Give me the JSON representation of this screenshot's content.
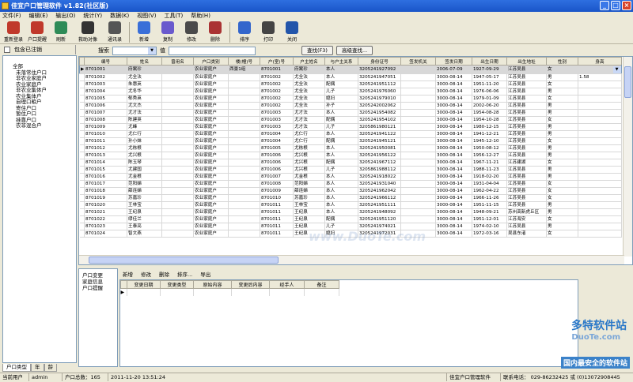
{
  "window": {
    "title": "佳宜户口管理软件  v1.82(社区版)"
  },
  "menu": [
    "文件(F)",
    "编辑(E)",
    "输出(O)",
    "统计(Y)",
    "数据(K)",
    "视图(V)",
    "工具(T)",
    "帮助(H)"
  ],
  "toolbar": [
    {
      "label": "重新登录",
      "icon": "relogin-icon",
      "color": "#c0392b"
    },
    {
      "label": "户口提醒",
      "icon": "reminder-icon",
      "color": "#c0392b"
    },
    {
      "label": "刷新",
      "icon": "refresh-icon",
      "color": "#2e8b57"
    },
    {
      "label": "救助对像",
      "icon": "aid-icon",
      "color": "#333"
    },
    {
      "label": "通讯录",
      "icon": "contacts-icon",
      "color": "#555"
    },
    {
      "label": "新增",
      "icon": "add-icon",
      "color": "#3a6fd8"
    },
    {
      "label": "复制",
      "icon": "copy-icon",
      "color": "#6a5acd"
    },
    {
      "label": "修改",
      "icon": "edit-icon",
      "color": "#4a4a4a"
    },
    {
      "label": "删除",
      "icon": "delete-icon",
      "color": "#a33"
    },
    {
      "label": "排序",
      "icon": "sort-icon",
      "color": "#3366cc"
    },
    {
      "label": "打印",
      "icon": "print-icon",
      "color": "#444"
    },
    {
      "label": "关闭",
      "icon": "close-icon",
      "color": "#2255aa"
    }
  ],
  "sidebar": {
    "include_deregistered": "包含已注销",
    "tree": [
      "全部",
      "未落常住户口",
      "非农业家庭户",
      "农业家庭户",
      "非农业集体户",
      "农业集体户",
      "自理口粮户",
      "寄住户口",
      "暂住户口",
      "挂靠户口",
      "农非混合户"
    ],
    "tabs": [
      "户口类型",
      "年",
      "龄"
    ]
  },
  "search": {
    "label": "搜索",
    "condition": "值",
    "button": "查找(F3)",
    "advanced": "高级查找..."
  },
  "grid": {
    "columns": [
      "编号",
      "姓名",
      "曾用名",
      "户口类别",
      "楼(幢)号",
      "户(室)号",
      "户主姓名",
      "与户主关系",
      "身份证号",
      "签发机关",
      "签发日期",
      "出生日期",
      "出生地址",
      "性别",
      "身高"
    ],
    "rows": [
      [
        "8701001",
        "府案珍",
        "",
        "农业家庭户",
        "西景1组",
        "8701001",
        "府案珍",
        "本人",
        "3205241927092",
        "",
        "2006-07-09",
        "1927-09-29",
        "江苏吴县",
        "女",
        ""
      ],
      [
        "8701002",
        "尤全法",
        "",
        "农业家庭户",
        "",
        "8701002",
        "尤全法",
        "本人",
        "3205241947051",
        "",
        "3000-08-14",
        "1947-05-17",
        "江苏吴县",
        "男",
        "1.58"
      ],
      [
        "8701003",
        "朱惠英",
        "",
        "农业家庭户",
        "",
        "8701002",
        "尤全法",
        "配偶",
        "3205241951112",
        "",
        "3000-08-14",
        "1951-11-20",
        "江苏吴县",
        "女",
        ""
      ],
      [
        "8701004",
        "尤冬华",
        "",
        "农业家庭户",
        "",
        "8701002",
        "尤全法",
        "儿子",
        "3205241976060",
        "",
        "3000-08-14",
        "1976-06-06",
        "江苏吴县",
        "男",
        ""
      ],
      [
        "8701005",
        "郁秀英",
        "",
        "农业家庭户",
        "",
        "8701002",
        "尤全法",
        "媳妇",
        "3205241979010",
        "",
        "3000-08-14",
        "1979-01-09",
        "江苏吴县",
        "女",
        ""
      ],
      [
        "8701006",
        "尤文杰",
        "",
        "农业家庭户",
        "",
        "8701002",
        "尤全法",
        "孙子",
        "3205242002062",
        "",
        "3000-08-14",
        "2002-06-20",
        "江苏吴县",
        "男",
        ""
      ],
      [
        "8701007",
        "尤才法",
        "",
        "农业家庭户",
        "",
        "8701003",
        "尤才法",
        "本人",
        "3205241954082",
        "",
        "3000-08-14",
        "1954-08-28",
        "江苏吴县",
        "男",
        ""
      ],
      [
        "8701008",
        "陈建英",
        "",
        "农业家庭户",
        "",
        "8701003",
        "尤才法",
        "配偶",
        "3205241954102",
        "",
        "3000-08-14",
        "1954-10-28",
        "江苏吴县",
        "女",
        ""
      ],
      [
        "8701009",
        "尤峰",
        "",
        "农业家庭户",
        "",
        "8701003",
        "尤才法",
        "儿子",
        "3205861980121",
        "",
        "3000-08-14",
        "1980-12-15",
        "江苏吴县",
        "男",
        ""
      ],
      [
        "8701010",
        "尤仁行",
        "",
        "农业家庭户",
        "",
        "8701004",
        "尤仁行",
        "本人",
        "3205241941122",
        "",
        "3000-08-14",
        "1941-12-21",
        "江苏吴县",
        "男",
        ""
      ],
      [
        "8701011",
        "孙小妹",
        "",
        "农业家庭户",
        "",
        "8701004",
        "尤仁行",
        "配偶",
        "3205241945121",
        "",
        "3000-08-14",
        "1945-12-10",
        "江苏吴县",
        "女",
        ""
      ],
      [
        "8701012",
        "尤栋根",
        "",
        "农业家庭户",
        "",
        "8701005",
        "尤栋根",
        "本人",
        "3205241950081",
        "",
        "3000-08-14",
        "1950-08-12",
        "江苏吴县",
        "男",
        ""
      ],
      [
        "8701013",
        "尤兴根",
        "",
        "农业家庭户",
        "",
        "8701006",
        "尤兴根",
        "本人",
        "3205241956122",
        "",
        "3000-08-14",
        "1956-12-27",
        "江苏吴县",
        "男",
        ""
      ],
      [
        "8701014",
        "陈玉琴",
        "",
        "农业家庭户",
        "",
        "8701006",
        "尤兴根",
        "配偶",
        "3205241967112",
        "",
        "3000-08-14",
        "1967-11-21",
        "江苏建湖",
        "女",
        ""
      ],
      [
        "8701015",
        "尤建国",
        "",
        "农业家庭户",
        "",
        "8701006",
        "尤兴根",
        "儿子",
        "3205861988112",
        "",
        "3000-08-14",
        "1988-11-23",
        "江苏吴县",
        "男",
        ""
      ],
      [
        "8701016",
        "尤金根",
        "",
        "农业家庭户",
        "",
        "8701007",
        "尤金根",
        "本人",
        "3205241918022",
        "",
        "3000-08-14",
        "1918-02-20",
        "江苏吴县",
        "男",
        ""
      ],
      [
        "8701017",
        "范阳娣",
        "",
        "农业家庭户",
        "",
        "8701008",
        "范阳娣",
        "本人",
        "3205241931040",
        "",
        "3000-08-14",
        "1931-04-04",
        "江苏吴县",
        "女",
        ""
      ],
      [
        "8701018",
        "薛连娣",
        "",
        "农业家庭户",
        "",
        "8701009",
        "薛连娣",
        "本人",
        "3205241962042",
        "",
        "3000-08-14",
        "1962-04-22",
        "江苏吴县",
        "女",
        ""
      ],
      [
        "8701019",
        "苏嘉珍",
        "",
        "农业家庭户",
        "",
        "8701010",
        "苏嘉珍",
        "本人",
        "3205241966112",
        "",
        "3000-08-14",
        "1966-11-26",
        "江苏吴县",
        "女",
        ""
      ],
      [
        "8701020",
        "王林宝",
        "",
        "农业家庭户",
        "",
        "8701011",
        "王林宝",
        "本人",
        "3205241951111",
        "",
        "3000-08-14",
        "1951-11-15",
        "江苏吴县",
        "男",
        ""
      ],
      [
        "8701021",
        "王纪泉",
        "",
        "农业家庭户",
        "",
        "8701011",
        "王纪泉",
        "本人",
        "3205241948092",
        "",
        "3000-08-14",
        "1948-09-21",
        "苏州高新虎丘区",
        "男",
        ""
      ],
      [
        "8701022",
        "缪佳兰",
        "",
        "农业家庭户",
        "",
        "8701011",
        "王纪泉",
        "配偶",
        "3205241951120",
        "",
        "3000-08-14",
        "1951-12-01",
        "江苏海安",
        "女",
        ""
      ],
      [
        "8701023",
        "王泰亮",
        "",
        "农业家庭户",
        "",
        "8701011",
        "王纪泉",
        "儿子",
        "3205241974021",
        "",
        "3000-08-14",
        "1974-02-10",
        "江苏吴县",
        "男",
        ""
      ],
      [
        "8701024",
        "智文燕",
        "",
        "农业家庭户",
        "",
        "8701011",
        "王纪泉",
        "媳妇",
        "3205241972031",
        "",
        "3000-08-14",
        "1972-03-16",
        "吴县东渚",
        "女",
        ""
      ]
    ]
  },
  "detail": {
    "tree": [
      "户口变更",
      "家庭信息",
      "户口提醒"
    ],
    "toolbar": [
      "新增",
      "修改",
      "删除",
      "排序...",
      "导出"
    ],
    "columns": [
      "变更日期",
      "变更类型",
      "原始内容",
      "变更后内容",
      "经手人",
      "备注"
    ]
  },
  "status": {
    "user_label": "当前用户",
    "user": "admin",
    "count": "户口总数：165",
    "time": "2011-11-20  13:51:24",
    "app": "佳宜户口管理软件",
    "contact": "联系电话： 029-86232425 或 (0)13072908445"
  },
  "watermark": {
    "line1": "多特软件站",
    "line2": "DuoTe.com",
    "line3": "国内最安全的软件站",
    "center": "www.DuoTe.com"
  }
}
